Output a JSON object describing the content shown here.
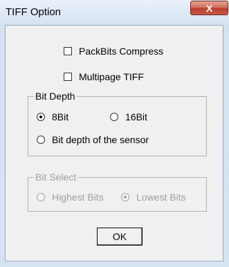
{
  "window": {
    "title": "TIFF Option",
    "close_label": "X"
  },
  "options": {
    "packbits": {
      "label": "PackBits Compress",
      "checked": false
    },
    "multipage": {
      "label": "Multipage TIFF",
      "checked": false
    }
  },
  "bit_depth": {
    "label": "Bit Depth",
    "options": [
      {
        "label": "8Bit",
        "selected": true
      },
      {
        "label": "16Bit",
        "selected": false
      },
      {
        "label": "Bit depth of the sensor",
        "selected": false
      }
    ]
  },
  "bit_select": {
    "label": "Bit Select",
    "enabled": false,
    "options": [
      {
        "label": "Highest Bits",
        "selected": false
      },
      {
        "label": "Lowest Bits",
        "selected": true
      }
    ]
  },
  "buttons": {
    "ok": "OK"
  }
}
